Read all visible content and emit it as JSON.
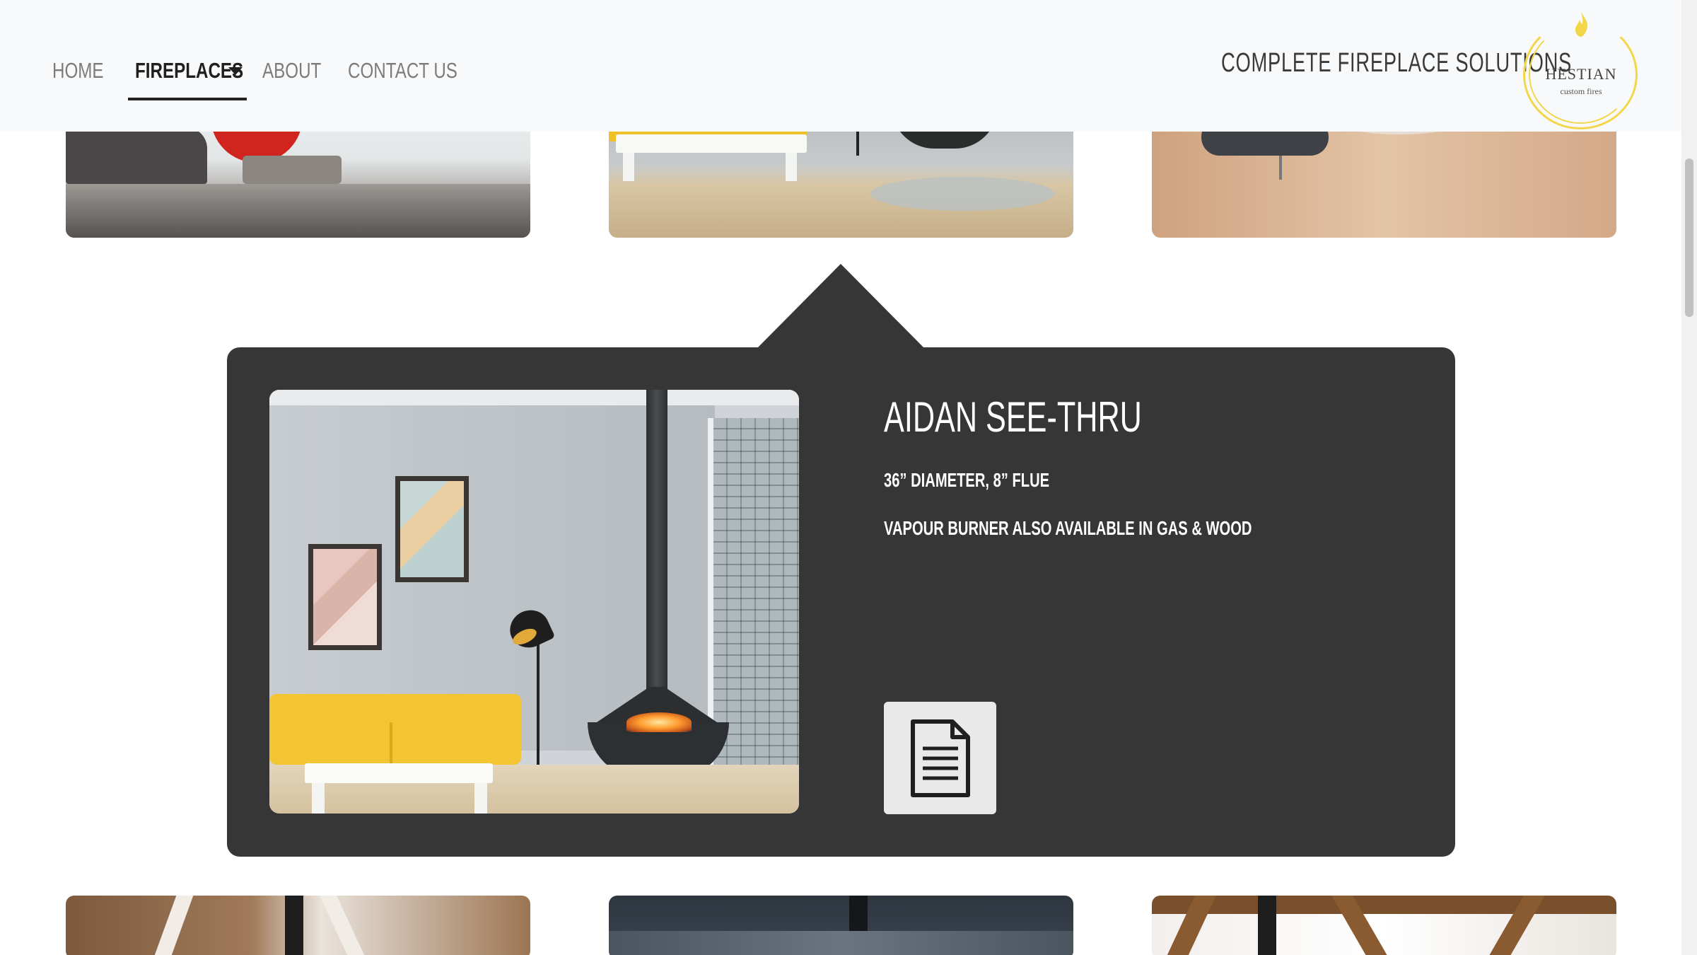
{
  "nav": {
    "items": [
      {
        "label": "HOME"
      },
      {
        "label": "FIREPLACES"
      },
      {
        "label": "ABOUT"
      },
      {
        "label": "CONTACT US"
      }
    ],
    "active_item": "FIREPLACES"
  },
  "header": {
    "tagline": "COMPLETE  FIREPLACE  SOLUTIONS",
    "logo": {
      "name": "HESTIAN",
      "sub": "custom fires"
    }
  },
  "detail": {
    "title": "AIDAN SEE-THRU",
    "specs": [
      "36” DIAMETER, 8” FLUE",
      "VAPOUR BURNER ALSO AVAILABLE IN GAS & WOOD"
    ],
    "document_icon": "document-icon"
  },
  "colors": {
    "panel": "#363636",
    "header": "#f8f9fa",
    "logo_gold": "#f2d64b",
    "active_underline": "#222222"
  }
}
